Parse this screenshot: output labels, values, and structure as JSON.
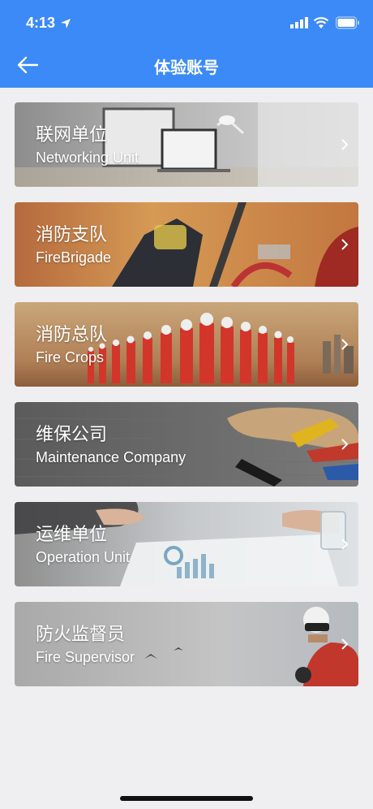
{
  "status_bar": {
    "time": "4:13"
  },
  "nav": {
    "title": "体验账号"
  },
  "cards": [
    {
      "cn": "联网单位",
      "en": "Networking Unit"
    },
    {
      "cn": "消防支队",
      "en": "FireBrigade"
    },
    {
      "cn": "消防总队",
      "en": "Fire Crops"
    },
    {
      "cn": "维保公司",
      "en": "Maintenance Company"
    },
    {
      "cn": "运维单位",
      "en": "Operation Unit"
    },
    {
      "cn": "防火监督员",
      "en": "Fire Supervisor"
    }
  ],
  "colors": {
    "header": "#3b8af7",
    "background": "#efeff1"
  }
}
